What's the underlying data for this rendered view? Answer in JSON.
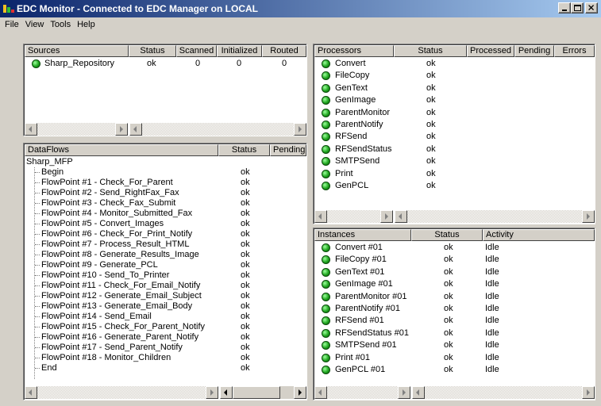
{
  "window": {
    "title": "EDC Monitor - Connected to EDC Manager on LOCAL"
  },
  "menu": [
    "File",
    "View",
    "Tools",
    "Help"
  ],
  "sources": {
    "headers": [
      "Sources",
      "Status",
      "Scanned",
      "Initialized",
      "Routed"
    ],
    "rows": [
      {
        "name": "Sharp_Repository",
        "status": "ok",
        "scanned": "0",
        "initialized": "0",
        "routed": "0"
      }
    ]
  },
  "processors": {
    "headers": [
      "Processors",
      "Status",
      "Processed",
      "Pending",
      "Errors"
    ],
    "rows": [
      {
        "name": "Convert",
        "status": "ok"
      },
      {
        "name": "FileCopy",
        "status": "ok"
      },
      {
        "name": "GenText",
        "status": "ok"
      },
      {
        "name": "GenImage",
        "status": "ok"
      },
      {
        "name": "ParentMonitor",
        "status": "ok"
      },
      {
        "name": "ParentNotify",
        "status": "ok"
      },
      {
        "name": "RFSend",
        "status": "ok"
      },
      {
        "name": "RFSendStatus",
        "status": "ok"
      },
      {
        "name": "SMTPSend",
        "status": "ok"
      },
      {
        "name": "Print",
        "status": "ok"
      },
      {
        "name": "GenPCL",
        "status": "ok"
      }
    ]
  },
  "dataflows": {
    "headers": [
      "DataFlows",
      "Status",
      "Pending"
    ],
    "root": "Sharp_MFP",
    "rows": [
      {
        "name": "Begin",
        "status": "ok"
      },
      {
        "name": "FlowPoint #1 - Check_For_Parent",
        "status": "ok"
      },
      {
        "name": "FlowPoint #2 - Send_RightFax_Fax",
        "status": "ok"
      },
      {
        "name": "FlowPoint #3 - Check_Fax_Submit",
        "status": "ok"
      },
      {
        "name": "FlowPoint #4 - Monitor_Submitted_Fax",
        "status": "ok"
      },
      {
        "name": "FlowPoint #5 - Convert_Images",
        "status": "ok"
      },
      {
        "name": "FlowPoint #6 - Check_For_Print_Notify",
        "status": "ok"
      },
      {
        "name": "FlowPoint #7 - Process_Result_HTML",
        "status": "ok"
      },
      {
        "name": "FlowPoint #8 - Generate_Results_Image",
        "status": "ok"
      },
      {
        "name": "FlowPoint #9 - Generate_PCL",
        "status": "ok"
      },
      {
        "name": "FlowPoint #10 - Send_To_Printer",
        "status": "ok"
      },
      {
        "name": "FlowPoint #11 - Check_For_Email_Notify",
        "status": "ok"
      },
      {
        "name": "FlowPoint #12 - Generate_Email_Subject",
        "status": "ok"
      },
      {
        "name": "FlowPoint #13 - Generate_Email_Body",
        "status": "ok"
      },
      {
        "name": "FlowPoint #14 - Send_Email",
        "status": "ok"
      },
      {
        "name": "FlowPoint #15 - Check_For_Parent_Notify",
        "status": "ok"
      },
      {
        "name": "FlowPoint #16 - Generate_Parent_Notify",
        "status": "ok"
      },
      {
        "name": "FlowPoint #17 - Send_Parent_Notify",
        "status": "ok"
      },
      {
        "name": "FlowPoint #18 - Monitor_Children",
        "status": "ok"
      },
      {
        "name": "End",
        "status": "ok"
      }
    ]
  },
  "instances": {
    "headers": [
      "Instances",
      "Status",
      "Activity"
    ],
    "rows": [
      {
        "name": "Convert #01",
        "status": "ok",
        "activity": "Idle"
      },
      {
        "name": "FileCopy #01",
        "status": "ok",
        "activity": "Idle"
      },
      {
        "name": "GenText #01",
        "status": "ok",
        "activity": "Idle"
      },
      {
        "name": "GenImage #01",
        "status": "ok",
        "activity": "Idle"
      },
      {
        "name": "ParentMonitor #01",
        "status": "ok",
        "activity": "Idle"
      },
      {
        "name": "ParentNotify #01",
        "status": "ok",
        "activity": "Idle"
      },
      {
        "name": "RFSend #01",
        "status": "ok",
        "activity": "Idle"
      },
      {
        "name": "RFSendStatus #01",
        "status": "ok",
        "activity": "Idle"
      },
      {
        "name": "SMTPSend #01",
        "status": "ok",
        "activity": "Idle"
      },
      {
        "name": "Print #01",
        "status": "ok",
        "activity": "Idle"
      },
      {
        "name": "GenPCL #01",
        "status": "ok",
        "activity": "Idle"
      }
    ]
  }
}
